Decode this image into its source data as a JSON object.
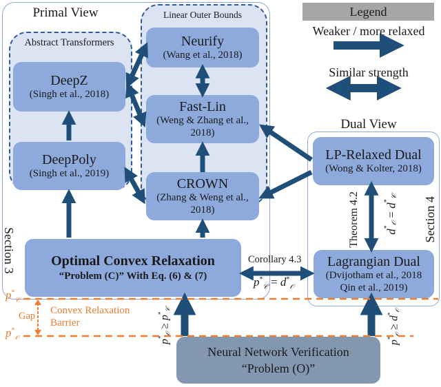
{
  "colors": {
    "node_fill": "#8eaadc",
    "group_fill": "#dce4f3",
    "group_border": "#2e5a9a",
    "arrow": "#1f4e79",
    "problem_fill": "#8497b0",
    "legend_header": "#a6a6a6",
    "barrier": "#ed7d31",
    "panel_border": "#8fa9d9"
  },
  "primal_view": {
    "title": "Primal View",
    "section_label": "Section 3",
    "abstract_transformers": {
      "title": "Abstract Transformers",
      "nodes": [
        {
          "name": "DeepZ",
          "citation": "(Singh et al., 2018)"
        },
        {
          "name": "DeepPoly",
          "citation": "(Singh et al., 2019)"
        }
      ]
    },
    "linear_outer_bounds": {
      "title": "Linear Outer Bounds",
      "nodes": [
        {
          "name": "Neurify",
          "citation": "(Wang et al., 2018)"
        },
        {
          "name": "Fast-Lin",
          "citation": "(Weng & Zhang et al., 2018)"
        },
        {
          "name": "CROWN",
          "citation": "(Zhang & Weng et al., 2018)"
        }
      ]
    },
    "optimal": {
      "name": "Optimal Convex Relaxation",
      "subtitle": "“Problem (C)” With Eq. (6) & (7)"
    }
  },
  "dual_view": {
    "title": "Dual View",
    "section_label": "Section 4",
    "nodes": [
      {
        "name": "LP-Relaxed Dual",
        "citation": "(Wong & Kolter, 2018)"
      },
      {
        "name": "Lagrangian Dual",
        "citation_line1": "(Dvijotham et al., 2018",
        "citation_line2": "Qin et al., 2019)"
      }
    ],
    "theorem_label": "Theorem 4.2",
    "theorem_eq": "d*O = d*C"
  },
  "verification": {
    "name": "Neural Network Verification",
    "subtitle": "“Problem (O)”"
  },
  "corollary": {
    "label": "Corollary 4.3",
    "eq": "p*C = d*O"
  },
  "barrier": {
    "label_top": "p*C",
    "label_bottom": "p*O",
    "gap": "Gap",
    "text_line1": "Convex Relaxation",
    "text_line2": "Barrier",
    "ineq_left": "p*O ≥ p*C",
    "ineq_right": "p*O ≥ d*O"
  },
  "legend": {
    "title": "Legend",
    "weaker": "Weaker / more relaxed",
    "similar": "Similar strength"
  }
}
